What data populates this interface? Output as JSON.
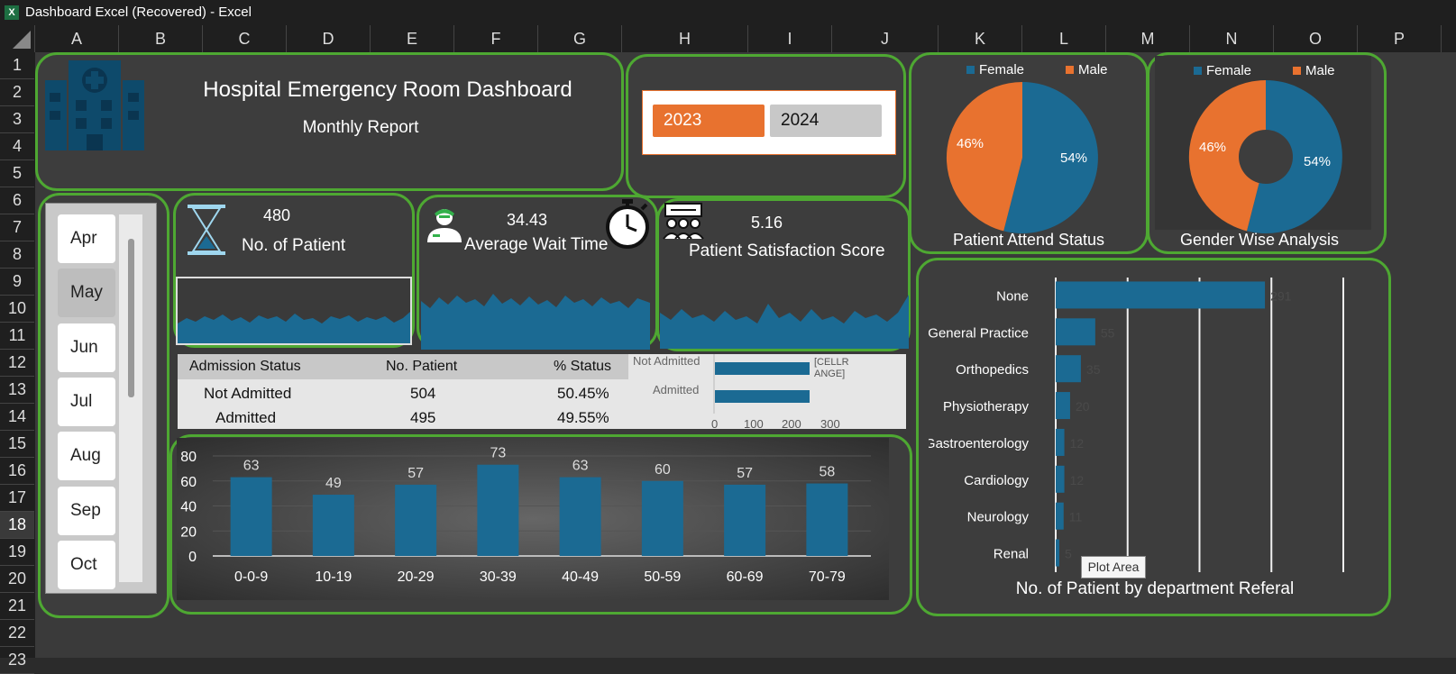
{
  "window": {
    "title": "Dashboard Excel (Recovered) - Excel",
    "app_icon": "excel-icon"
  },
  "columns": [
    "A",
    "B",
    "C",
    "D",
    "E",
    "F",
    "G",
    "H",
    "I",
    "J",
    "K",
    "L",
    "M",
    "N",
    "O",
    "P"
  ],
  "rows": [
    "1",
    "2",
    "3",
    "4",
    "5",
    "6",
    "7",
    "8",
    "9",
    "10",
    "11",
    "12",
    "13",
    "14",
    "15",
    "16",
    "17",
    "18",
    "19",
    "20",
    "21",
    "22",
    "23"
  ],
  "selected_row": "18",
  "header": {
    "title": "Hospital Emergency Room Dashboard",
    "subtitle": "Monthly Report",
    "icon": "hospital-icon"
  },
  "years": {
    "selected": "2023",
    "other": "2024",
    "selected_color": "#e8722f"
  },
  "months": [
    "Apr",
    "May",
    "Jun",
    "Jul",
    "Aug",
    "Sep",
    "Oct"
  ],
  "selected_month": "May",
  "kpis": {
    "patients": {
      "value": "480",
      "label": "No. of Patient",
      "icon": "hourglass-icon"
    },
    "wait": {
      "value": "34.43",
      "label": "Average Wait Time",
      "icon": "nurse-icon"
    },
    "satisfaction": {
      "value": "5.16",
      "label": "Patient Satisfaction Score",
      "icon": "stopwatch-icon",
      "icon2": "meeting-icon"
    }
  },
  "admission": {
    "headers": [
      "Admission Status",
      "No. Patient",
      "% Status"
    ],
    "rows": [
      {
        "status": "Not Admitted",
        "count": "504",
        "pct": "50.45%"
      },
      {
        "status": "Admitted",
        "count": "495",
        "pct": "49.55%"
      }
    ],
    "mini_chart": {
      "labels": [
        "Not Admitted",
        "Admitted"
      ],
      "values": [
        504,
        495
      ],
      "ticks": [
        "0",
        "100",
        "200",
        "300"
      ],
      "data_label": "[CELLR ANGE]"
    }
  },
  "gender": {
    "attend": {
      "title": "Patient Attend Status",
      "legend": [
        "Female",
        "Male"
      ],
      "female_pct": "54%",
      "male_pct": "46%"
    },
    "analysis": {
      "title": "Gender Wise Analysis",
      "legend": [
        "Female",
        "Male"
      ],
      "female_pct": "54%",
      "male_pct": "46%"
    },
    "colors": {
      "female": "#1b6a93",
      "male": "#e8722f"
    }
  },
  "chart_data": [
    {
      "type": "bar",
      "title": "",
      "categories": [
        "0-0-9",
        "10-19",
        "20-29",
        "30-39",
        "40-49",
        "50-59",
        "60-69",
        "70-79"
      ],
      "values": [
        63,
        49,
        57,
        73,
        63,
        60,
        57,
        58
      ],
      "yticks": [
        "0",
        "20",
        "40",
        "60",
        "80"
      ],
      "ylim": [
        0,
        80
      ],
      "color": "#1b6a93"
    },
    {
      "type": "bar",
      "orientation": "horizontal",
      "title": "No. of Patient by department Referal",
      "categories": [
        "None",
        "General Practice",
        "Orthopedics",
        "Physiotherapy",
        "Gastroenterology",
        "Cardiology",
        "Neurology",
        "Renal"
      ],
      "values": [
        291,
        55,
        35,
        20,
        12,
        12,
        11,
        5
      ],
      "xlim": [
        0,
        400
      ],
      "color": "#1b6a93"
    }
  ],
  "tooltip": "Plot Area"
}
